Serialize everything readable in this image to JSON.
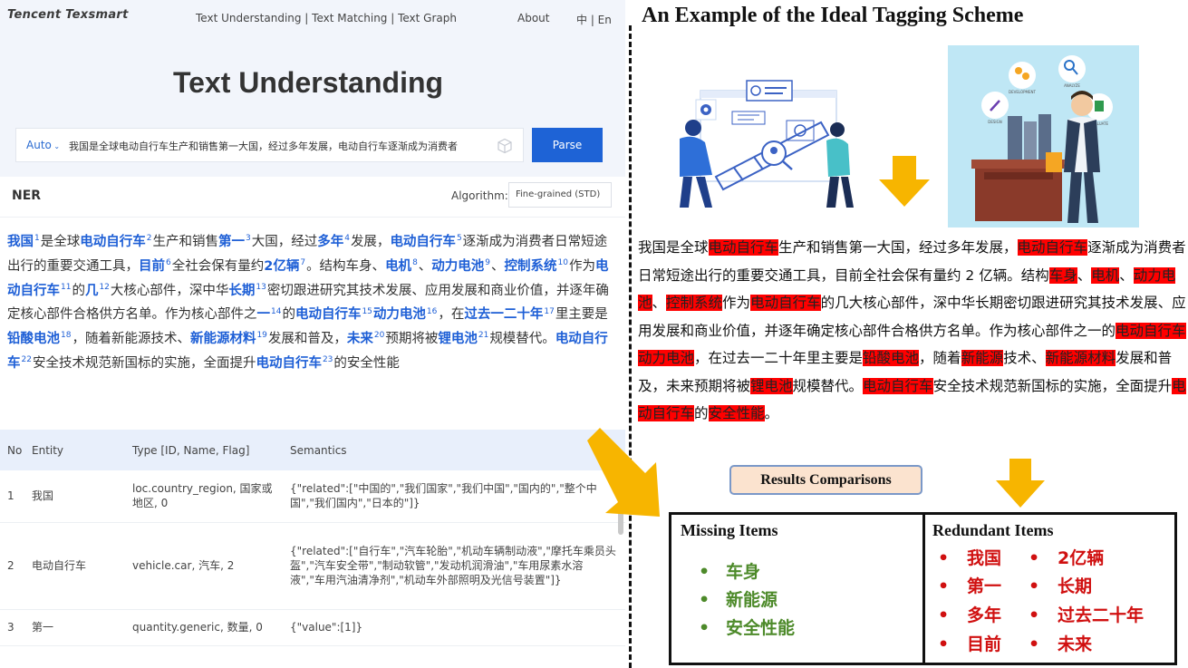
{
  "app": {
    "brand": "Tencent Texsmart",
    "nav": "Text Understanding | Text Matching | Text Graph",
    "about": "About",
    "lang": "中 | En",
    "page_title": "Text Understanding"
  },
  "search": {
    "mode": "Auto",
    "value": "我国是全球电动自行车生产和销售第一大国，经过多年发展，电动自行车逐渐成为消费者",
    "button": "Parse"
  },
  "ner": {
    "heading": "NER",
    "algorithm_label": "Algorithm:",
    "algorithm_value": "Fine-grained (STD)",
    "segments": [
      {
        "t": "我国",
        "e": true,
        "n": "1"
      },
      {
        "t": "是全球"
      },
      {
        "t": "电动自行车",
        "e": true,
        "n": "2"
      },
      {
        "t": "生产和销售"
      },
      {
        "t": "第一",
        "e": true,
        "n": "3"
      },
      {
        "t": "大国，经过"
      },
      {
        "t": "多年",
        "e": true,
        "n": "4"
      },
      {
        "t": "发展，"
      },
      {
        "t": "电动自行车",
        "e": true,
        "n": "5"
      },
      {
        "t": "逐渐成为消费者日常短途出行的重要交通工具，"
      },
      {
        "t": "目前",
        "e": true,
        "n": "6"
      },
      {
        "t": "全社会保有量约"
      },
      {
        "t": "2亿辆",
        "e": true,
        "n": "7"
      },
      {
        "t": "。结构车身、"
      },
      {
        "t": "电机",
        "e": true,
        "n": "8"
      },
      {
        "t": "、"
      },
      {
        "t": "动力电池",
        "e": true,
        "n": "9"
      },
      {
        "t": "、"
      },
      {
        "t": "控制系统",
        "e": true,
        "n": "10"
      },
      {
        "t": "作为"
      },
      {
        "t": "电动自行车",
        "e": true,
        "n": "11"
      },
      {
        "t": "的"
      },
      {
        "t": "几",
        "e": true,
        "n": "12"
      },
      {
        "t": "大核心部件，深中华"
      },
      {
        "t": "长期",
        "e": true,
        "n": "13"
      },
      {
        "t": "密切跟进研究其技术发展、应用发展和商业价值，并逐年确定核心部件合格供方名单。作为核心部件之"
      },
      {
        "t": "一",
        "e": true,
        "n": "14"
      },
      {
        "t": "的"
      },
      {
        "t": "电动自行车",
        "e": true,
        "n": "15"
      },
      {
        "t": "动力电池",
        "e": true,
        "n": "16"
      },
      {
        "t": "，在"
      },
      {
        "t": "过去一二十年",
        "e": true,
        "n": "17"
      },
      {
        "t": "里主要是"
      },
      {
        "t": "铅酸电池",
        "e": true,
        "n": "18"
      },
      {
        "t": "，随着新能源技术、"
      },
      {
        "t": "新能源材料",
        "e": true,
        "n": "19"
      },
      {
        "t": "发展和普及，"
      },
      {
        "t": "未来",
        "e": true,
        "n": "20"
      },
      {
        "t": "预期将被"
      },
      {
        "t": "锂电池",
        "e": true,
        "n": "21"
      },
      {
        "t": "规模替代。"
      },
      {
        "t": "电动自行车",
        "e": true,
        "n": "22"
      },
      {
        "t": "安全技术规范新国标的实施，全面提升"
      },
      {
        "t": "电动自行车",
        "e": true,
        "n": "23"
      },
      {
        "t": "的安全性能"
      }
    ]
  },
  "table": {
    "headers": [
      "No",
      "Entity",
      "Type [ID, Name, Flag]",
      "Semantics"
    ],
    "rows": [
      [
        "1",
        "我国",
        "loc.country_region, 国家或地区, 0",
        "{\"related\":[\"中国的\",\"我们国家\",\"我们中国\",\"国内的\",\"整个中国\",\"我们国内\",\"日本的\"]}"
      ],
      [
        "2",
        "电动自行车",
        "vehicle.car, 汽车, 2",
        "{\"related\":[\"自行车\",\"汽车轮胎\",\"机动车辆制动液\",\"摩托车乘员头盔\",\"汽车安全带\",\"制动软管\",\"发动机润滑油\",\"车用尿素水溶液\",\"车用汽油清净剂\",\"机动车外部照明及光信号装置\"]}"
      ],
      [
        "3",
        "第一",
        "quantity.generic, 数量, 0",
        "{\"value\":[1]}"
      ]
    ]
  },
  "right": {
    "title": "An Example of the Ideal Tagging Scheme",
    "segments": [
      {
        "t": "我国是全球"
      },
      {
        "t": "电动自行车",
        "h": true
      },
      {
        "t": "生产和销售第一大国，经过多年发展，"
      },
      {
        "t": "电动自行车",
        "h": true
      },
      {
        "t": "逐渐成为消费者日常短途出行的重要交通工具，目前全社会保有量约 2 亿辆。结构"
      },
      {
        "t": "车身",
        "h": true
      },
      {
        "t": "、"
      },
      {
        "t": "电机",
        "h": true
      },
      {
        "t": "、"
      },
      {
        "t": "动力电池",
        "h": true
      },
      {
        "t": "、"
      },
      {
        "t": "控制系统",
        "h": true
      },
      {
        "t": "作为"
      },
      {
        "t": "电动自行车",
        "h": true
      },
      {
        "t": "的几大核心部件，深中华长期密切跟进研究其技术发展、应用发展和商业价值，并逐年确定核心部件合格供方名单。作为核心部件之一的"
      },
      {
        "t": "电动自行车动力电池",
        "h": true
      },
      {
        "t": "，在过去一二十年里主要是"
      },
      {
        "t": "铅酸电池",
        "h": true
      },
      {
        "t": "，随着"
      },
      {
        "t": "新能源",
        "h": true
      },
      {
        "t": "技术、"
      },
      {
        "t": "新能源材料",
        "h": true
      },
      {
        "t": "发展和普及，未来预期将被"
      },
      {
        "t": "锂电池",
        "h": true
      },
      {
        "t": "规模替代。"
      },
      {
        "t": "电动自行车",
        "h": true
      },
      {
        "t": "安全技术规范新国标的实施，全面提升"
      },
      {
        "t": "电动自行车",
        "h": true
      },
      {
        "t": "的"
      },
      {
        "t": "安全性能",
        "h": true
      },
      {
        "t": "。"
      }
    ],
    "results_label": "Results Comparisons",
    "missing_title": "Missing Items",
    "missing": [
      "车身",
      "新能源",
      "安全性能"
    ],
    "redundant_title": "Redundant Items",
    "redundant_col1": [
      "我国",
      "第一",
      "多年",
      "目前"
    ],
    "redundant_col2": [
      "2亿辆",
      "长期",
      "过去二十年",
      "未来"
    ],
    "bullet": "•"
  },
  "icon_labels": [
    "DEVELOPMENT",
    "ANALYZE",
    "DESIGN",
    "EVALUATE"
  ],
  "colors": {
    "entity": "#1e5fd6",
    "highlight": "#ff0000",
    "missing": "#4d8a2a",
    "redundant": "#d01010",
    "arrow": "#f7b500",
    "parse_button": "#1e63d6"
  }
}
